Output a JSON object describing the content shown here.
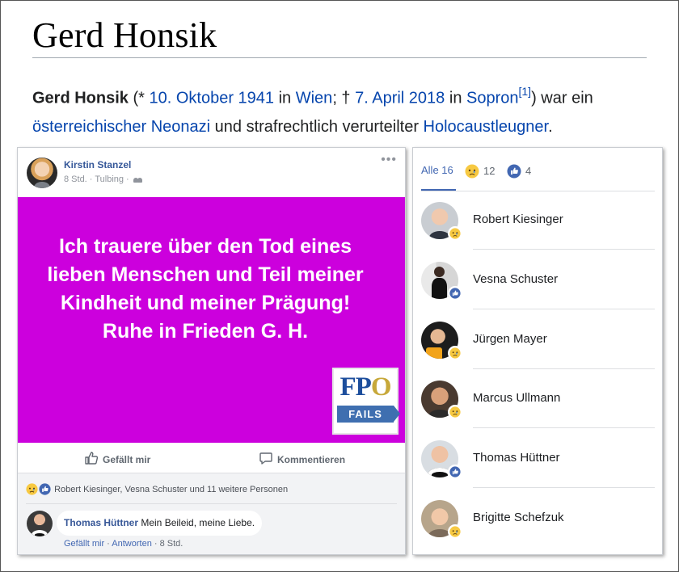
{
  "wiki": {
    "title": "Gerd Honsik",
    "intro": {
      "name": "Gerd Honsik",
      "open": " (* ",
      "birth_date": "10. Oktober 1941",
      "t1": " in ",
      "birth_place": "Wien",
      "t2": "; † ",
      "death_date": "7. April 2018",
      "t3": " in ",
      "death_place": "Sopron",
      "footnote": "[1]",
      "t4": ") war ein ",
      "link_neonazi": "österreichischer Neonazi",
      "t5": " und strafrechtlich verurteilter ",
      "link_denier": "Holocaustleugner",
      "t6": "."
    }
  },
  "post": {
    "author": "Kirstin Stanzel",
    "time": "8 Std.",
    "sep": " · ",
    "place": "Tulbing",
    "sep2": " · ",
    "more": "•••",
    "image_text": "Ich trauere über den Tod eines lieben Menschen und Teil meiner Kindheit und meiner Prägung! Ruhe in Frieden G. H.",
    "logo": {
      "fp": "FP",
      "o": "O",
      "fails": "FAILS"
    },
    "actions": {
      "like": "Gefällt mir",
      "comment": "Kommentieren"
    },
    "reactions_summary": "Robert Kiesinger, Vesna Schuster und 11 weitere Personen",
    "comment": {
      "author": "Thomas Hüttner",
      "text": " Mein Beileid, meine Liebe.",
      "like": "Gefällt mir",
      "sep": " · ",
      "reply": "Antworten",
      "sep2": " · ",
      "time": "8 Std."
    }
  },
  "reactions_panel": {
    "tabs": [
      {
        "label": "Alle 16",
        "icon": "none"
      },
      {
        "label": "12",
        "icon": "sad-icon"
      },
      {
        "label": "4",
        "icon": "like-icon"
      }
    ],
    "people": [
      {
        "name": "Robert Kiesinger",
        "reaction": "sad-icon"
      },
      {
        "name": "Vesna Schuster",
        "reaction": "like-icon"
      },
      {
        "name": "Jürgen Mayer",
        "reaction": "sad-icon"
      },
      {
        "name": "Marcus Ullmann",
        "reaction": "sad-icon"
      },
      {
        "name": "Thomas Hüttner",
        "reaction": "like-icon"
      },
      {
        "name": "Brigitte Schefzuk",
        "reaction": "sad-icon"
      }
    ]
  },
  "colors": {
    "image_bg": "#cc00dd",
    "fb_link": "#365899",
    "wiki_link": "#0645ad",
    "like_blue": "#4267b2",
    "sad_yellow": "#f7c942"
  }
}
